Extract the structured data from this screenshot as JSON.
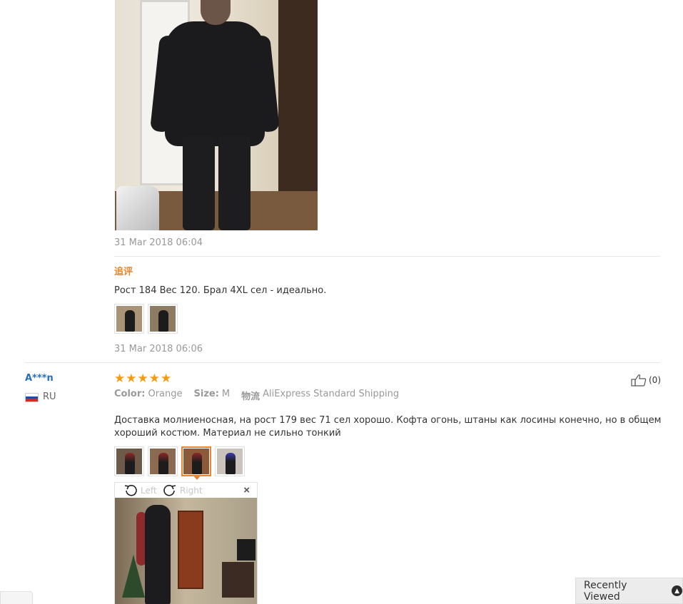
{
  "first_review": {
    "date_1": "31 Mar 2018 06:04",
    "followup_label": "追评",
    "followup_text": "Рост 184 Вес 120. Брал 4XL сел - идеально.",
    "date_2": "31 Mar 2018 06:06",
    "thumbnail_count": 2
  },
  "second_review": {
    "user_name": "A***n",
    "country": "RU",
    "rating": 5,
    "stars": [
      "★",
      "★",
      "★",
      "★",
      "★"
    ],
    "color_label": "Color:",
    "color_value": "Orange",
    "size_label": "Size:",
    "size_value": "M",
    "shipping_label": "物流",
    "shipping_value": "AliExpress Standard Shipping",
    "helpful_count": "(0)",
    "text": "Доставка молниеносная, на рост 179 вес 71 сел хорошо. Кофта огонь, штаны как лосины конечно, но в общем хороший костюм. Материал не сильно тонкий",
    "thumbnail_count": 4,
    "active_thumbnail": 3
  },
  "image_viewer": {
    "rotate_left_label": "Left",
    "rotate_right_label": "Right",
    "close_symbol": "×"
  },
  "recently_viewed": {
    "label": "Recently Viewed",
    "icon": "chevron-up-icon"
  },
  "colors": {
    "accent_orange": "#e9852f",
    "star": "#f39c12",
    "username_blue": "#2a6ebb"
  }
}
